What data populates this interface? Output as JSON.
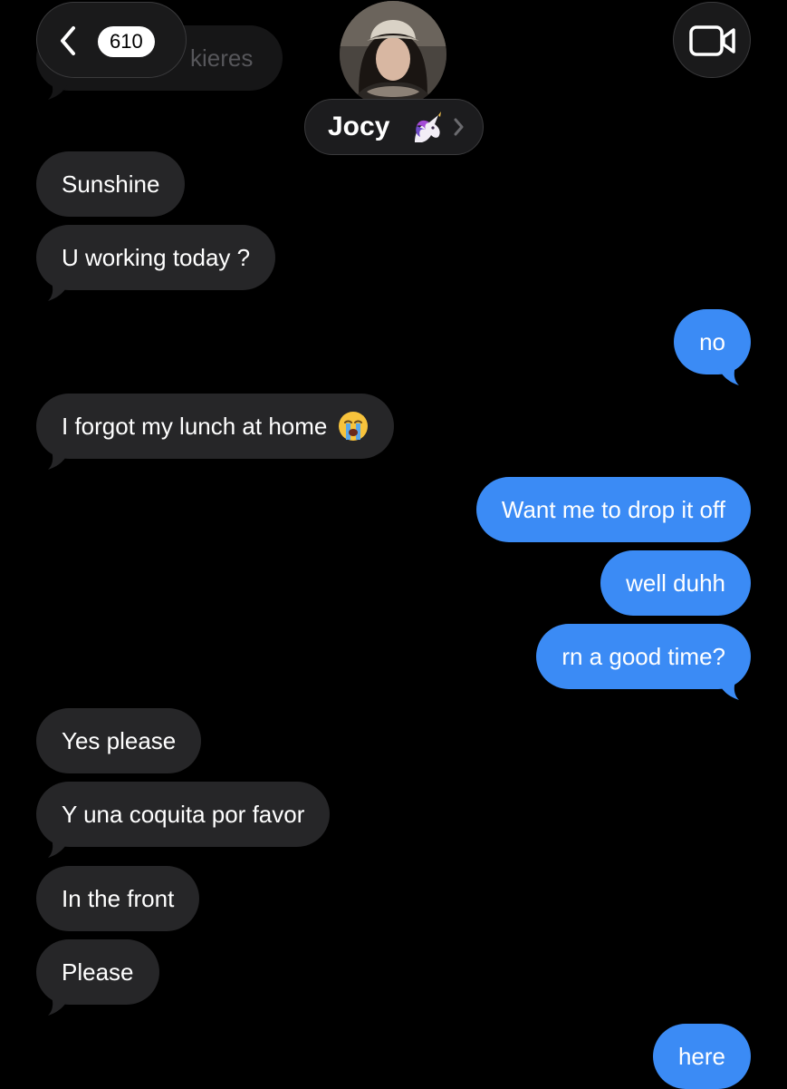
{
  "header": {
    "back_count": "610",
    "contact_name": "Jocy",
    "name_emoji_icon": "unicorn-icon",
    "video_icon": "video-camera-icon",
    "back_icon": "chevron-left-icon"
  },
  "ghost_message": {
    "text": "kieres"
  },
  "messages": [
    {
      "from": "contact",
      "text": "Sunshine"
    },
    {
      "from": "contact",
      "text": "U working today ?"
    },
    {
      "from": "me",
      "text": "no"
    },
    {
      "from": "contact",
      "text": "I forgot my lunch at home",
      "emoji_icon": "loudly-crying-face-icon"
    },
    {
      "from": "me",
      "text": "Want me to drop it off"
    },
    {
      "from": "me",
      "text": "well duhh"
    },
    {
      "from": "me",
      "text": "rn a good time?"
    },
    {
      "from": "contact",
      "text": "Yes please"
    },
    {
      "from": "contact",
      "text": "Y una coquita por favor"
    },
    {
      "from": "contact",
      "text": "In the front"
    },
    {
      "from": "contact",
      "text": "Please"
    },
    {
      "from": "me",
      "text": "here"
    }
  ],
  "colors": {
    "background": "#000000",
    "incoming_bubble": "#262628",
    "outgoing_bubble": "#3b8bf5",
    "text": "#ffffff"
  }
}
